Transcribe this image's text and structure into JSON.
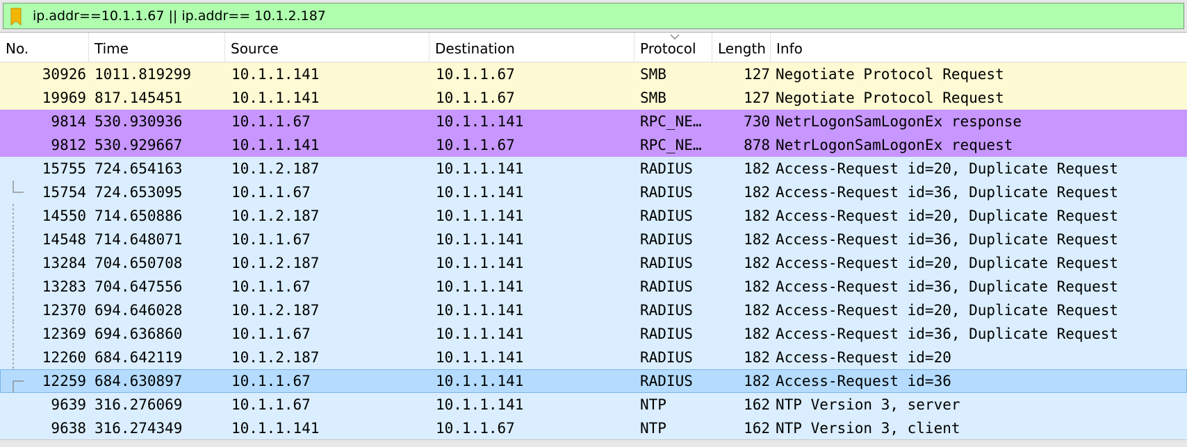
{
  "filter": {
    "value": "ip.addr==10.1.1.67 || ip.addr== 10.1.2.187",
    "background": "#afffaf"
  },
  "bookmark": {
    "icon": "bookmark-icon",
    "color": "#f2b705"
  },
  "columns": [
    {
      "key": "no",
      "label": "No."
    },
    {
      "key": "time",
      "label": "Time"
    },
    {
      "key": "source",
      "label": "Source"
    },
    {
      "key": "destination",
      "label": "Destination"
    },
    {
      "key": "protocol",
      "label": "Protocol"
    },
    {
      "key": "length",
      "label": "Length"
    },
    {
      "key": "info",
      "label": "Info"
    }
  ],
  "sorted_column": "protocol",
  "row_colors": {
    "smb": "#fefad3",
    "rpc": "#c797ff",
    "udp": "#daeeff",
    "selected": "#b5dcff"
  },
  "rows": [
    {
      "no": "30926",
      "time": "1011.819299",
      "source": "10.1.1.141",
      "destination": "10.1.1.67",
      "protocol": "SMB",
      "length": "127",
      "info": "Negotiate Protocol Request",
      "color": "smb",
      "marker": ""
    },
    {
      "no": "19969",
      "time": "817.145451",
      "source": "10.1.1.141",
      "destination": "10.1.1.67",
      "protocol": "SMB",
      "length": "127",
      "info": "Negotiate Protocol Request",
      "color": "smb",
      "marker": ""
    },
    {
      "no": "9814",
      "time": "530.930936",
      "source": "10.1.1.67",
      "destination": "10.1.1.141",
      "protocol": "RPC_NE…",
      "length": "730",
      "info": "NetrLogonSamLogonEx response",
      "color": "rpc",
      "marker": ""
    },
    {
      "no": "9812",
      "time": "530.929667",
      "source": "10.1.1.141",
      "destination": "10.1.1.67",
      "protocol": "RPC_NE…",
      "length": "878",
      "info": "NetrLogonSamLogonEx request",
      "color": "rpc",
      "marker": ""
    },
    {
      "no": "15755",
      "time": "724.654163",
      "source": "10.1.2.187",
      "destination": "10.1.1.141",
      "protocol": "RADIUS",
      "length": "182",
      "info": "Access-Request id=20, Duplicate Request",
      "color": "udp",
      "marker": ""
    },
    {
      "no": "15754",
      "time": "724.653095",
      "source": "10.1.1.67",
      "destination": "10.1.1.141",
      "protocol": "RADIUS",
      "length": "182",
      "info": "Access-Request id=36, Duplicate Request",
      "color": "udp",
      "marker": "end"
    },
    {
      "no": "14550",
      "time": "714.650886",
      "source": "10.1.2.187",
      "destination": "10.1.1.141",
      "protocol": "RADIUS",
      "length": "182",
      "info": "Access-Request id=20, Duplicate Request",
      "color": "udp",
      "marker": "mid"
    },
    {
      "no": "14548",
      "time": "714.648071",
      "source": "10.1.1.67",
      "destination": "10.1.1.141",
      "protocol": "RADIUS",
      "length": "182",
      "info": "Access-Request id=36, Duplicate Request",
      "color": "udp",
      "marker": "mid"
    },
    {
      "no": "13284",
      "time": "704.650708",
      "source": "10.1.2.187",
      "destination": "10.1.1.141",
      "protocol": "RADIUS",
      "length": "182",
      "info": "Access-Request id=20, Duplicate Request",
      "color": "udp",
      "marker": "mid"
    },
    {
      "no": "13283",
      "time": "704.647556",
      "source": "10.1.1.67",
      "destination": "10.1.1.141",
      "protocol": "RADIUS",
      "length": "182",
      "info": "Access-Request id=36, Duplicate Request",
      "color": "udp",
      "marker": "mid"
    },
    {
      "no": "12370",
      "time": "694.646028",
      "source": "10.1.2.187",
      "destination": "10.1.1.141",
      "protocol": "RADIUS",
      "length": "182",
      "info": "Access-Request id=20, Duplicate Request",
      "color": "udp",
      "marker": "mid"
    },
    {
      "no": "12369",
      "time": "694.636860",
      "source": "10.1.1.67",
      "destination": "10.1.1.141",
      "protocol": "RADIUS",
      "length": "182",
      "info": "Access-Request id=36, Duplicate Request",
      "color": "udp",
      "marker": "mid"
    },
    {
      "no": "12260",
      "time": "684.642119",
      "source": "10.1.2.187",
      "destination": "10.1.1.141",
      "protocol": "RADIUS",
      "length": "182",
      "info": "Access-Request id=20",
      "color": "udp",
      "marker": "mid"
    },
    {
      "no": "12259",
      "time": "684.630897",
      "source": "10.1.1.67",
      "destination": "10.1.1.141",
      "protocol": "RADIUS",
      "length": "182",
      "info": "Access-Request id=36",
      "color": "selected",
      "marker": "start",
      "selected": true
    },
    {
      "no": "9639",
      "time": "316.276069",
      "source": "10.1.1.67",
      "destination": "10.1.1.141",
      "protocol": "NTP",
      "length": "162",
      "info": "NTP Version 3, server",
      "color": "udp",
      "marker": ""
    },
    {
      "no": "9638",
      "time": "316.274349",
      "source": "10.1.1.141",
      "destination": "10.1.1.67",
      "protocol": "NTP",
      "length": "162",
      "info": "NTP Version 3, client",
      "color": "udp",
      "marker": ""
    }
  ]
}
